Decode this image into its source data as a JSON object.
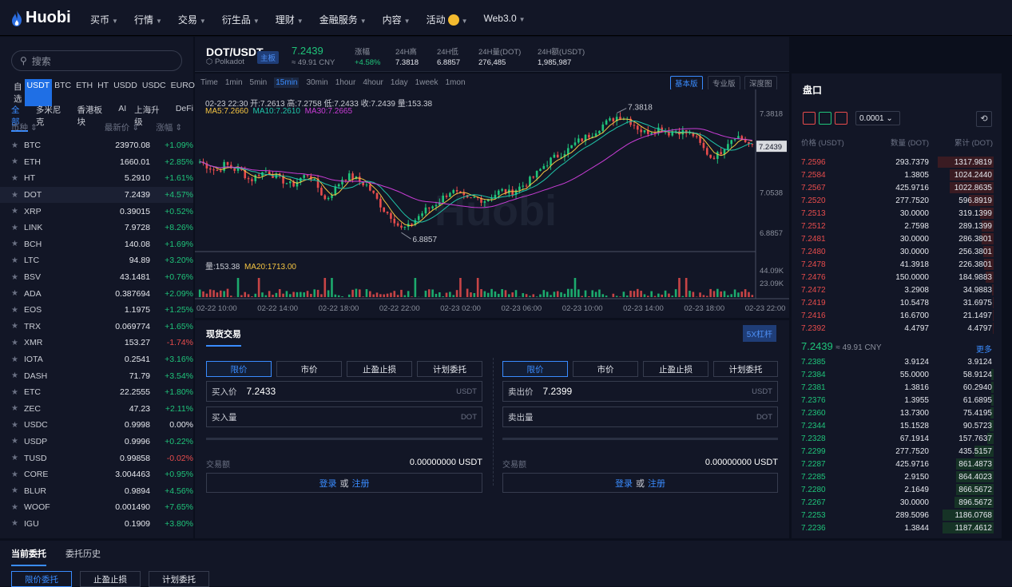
{
  "nav": {
    "logo": "Huobi",
    "items": [
      "买币",
      "行情",
      "交易",
      "衍生品",
      "理财",
      "金融服务",
      "内容",
      "活动",
      "Web3.0"
    ]
  },
  "market": {
    "search_placeholder": "搜索",
    "quote_tabs": [
      "自选",
      "USDT",
      "BTC",
      "ETH",
      "HT",
      "USDD",
      "USDC",
      "EUROC"
    ],
    "category_tabs": [
      "全部",
      "多米尼克",
      "香港板块",
      "AI",
      "上海升级",
      "DeFi"
    ],
    "headers": {
      "coin": "币种 ⇕",
      "price": "最新价 ⇕",
      "change": "涨幅 ⇕"
    },
    "rows": [
      {
        "sym": "BTC",
        "price": "23970.08",
        "change": "+1.09%",
        "dir": "up"
      },
      {
        "sym": "ETH",
        "price": "1660.01",
        "change": "+2.85%",
        "dir": "up"
      },
      {
        "sym": "HT",
        "price": "5.2910",
        "change": "+1.61%",
        "dir": "up"
      },
      {
        "sym": "DOT",
        "price": "7.2439",
        "change": "+4.57%",
        "dir": "up"
      },
      {
        "sym": "XRP",
        "price": "0.39015",
        "change": "+0.52%",
        "dir": "up"
      },
      {
        "sym": "LINK",
        "price": "7.9728",
        "change": "+8.26%",
        "dir": "up"
      },
      {
        "sym": "BCH",
        "price": "140.08",
        "change": "+1.69%",
        "dir": "up"
      },
      {
        "sym": "LTC",
        "price": "94.89",
        "change": "+3.20%",
        "dir": "up"
      },
      {
        "sym": "BSV",
        "price": "43.1481",
        "change": "+0.76%",
        "dir": "up"
      },
      {
        "sym": "ADA",
        "price": "0.387694",
        "change": "+2.09%",
        "dir": "up"
      },
      {
        "sym": "EOS",
        "price": "1.1975",
        "change": "+1.25%",
        "dir": "up"
      },
      {
        "sym": "TRX",
        "price": "0.069774",
        "change": "+1.65%",
        "dir": "up"
      },
      {
        "sym": "XMR",
        "price": "153.27",
        "change": "-1.74%",
        "dir": "dn"
      },
      {
        "sym": "IOTA",
        "price": "0.2541",
        "change": "+3.16%",
        "dir": "up"
      },
      {
        "sym": "DASH",
        "price": "71.79",
        "change": "+3.54%",
        "dir": "up"
      },
      {
        "sym": "ETC",
        "price": "22.2555",
        "change": "+1.80%",
        "dir": "up"
      },
      {
        "sym": "ZEC",
        "price": "47.23",
        "change": "+2.11%",
        "dir": "up"
      },
      {
        "sym": "USDC",
        "price": "0.9998",
        "change": "0.00%",
        "dir": "flat"
      },
      {
        "sym": "USDP",
        "price": "0.9996",
        "change": "+0.22%",
        "dir": "up"
      },
      {
        "sym": "TUSD",
        "price": "0.99858",
        "change": "-0.02%",
        "dir": "dn"
      },
      {
        "sym": "CORE",
        "price": "3.004463",
        "change": "+0.95%",
        "dir": "up"
      },
      {
        "sym": "BLUR",
        "price": "0.9894",
        "change": "+4.56%",
        "dir": "up"
      },
      {
        "sym": "WOOF",
        "price": "0.001490",
        "change": "+7.65%",
        "dir": "up"
      },
      {
        "sym": "IGU",
        "price": "0.1909",
        "change": "+3.80%",
        "dir": "up"
      }
    ]
  },
  "symbol": {
    "pair": "DOT/USDT",
    "name": "Polkadot",
    "badge": "主板",
    "price": "7.2439",
    "price_cny": "≈ 49.91 CNY",
    "stats": [
      {
        "label": "涨幅",
        "value": "+4.58%"
      },
      {
        "label": "24H高",
        "value": "7.3818"
      },
      {
        "label": "24H低",
        "value": "6.8857"
      },
      {
        "label": "24H量(DOT)",
        "value": "276,485"
      },
      {
        "label": "24H额(USDT)",
        "value": "1,985,987"
      }
    ]
  },
  "chart_toolbar": {
    "intervals": [
      "Time",
      "1min",
      "5min",
      "15min",
      "30min",
      "1hour",
      "4hour",
      "1day",
      "1week",
      "1mon"
    ],
    "active": "15min",
    "views": [
      "基本版",
      "专业版",
      "深度图"
    ]
  },
  "chart_info": {
    "ohlc": "02-23 22:30  开:7.2613  高:7.2758  低:7.2433  收:7.2439  量:153.38",
    "ma5": "MA5:7.2660",
    "ma10": "MA10:7.2610",
    "ma30": "MA30:7.2665",
    "vol": "量:153.38",
    "ma20": "MA20:1713.00",
    "high_label": "7.3818",
    "low_label": "6.8857",
    "last": "7.2439",
    "watermark": "Huobi"
  },
  "chart_data": {
    "type": "candlestick",
    "price_ticks": [
      "7.3818",
      "7.0538",
      "6.8857"
    ],
    "vol_ticks": [
      "44.09K",
      "23.09K"
    ],
    "x_ticks": [
      "02-22 10:00",
      "02-22 14:00",
      "02-22 18:00",
      "02-22 22:00",
      "02-23 02:00",
      "02-23 06:00",
      "02-23 10:00",
      "02-23 14:00",
      "02-23 18:00",
      "02-23 22:00"
    ],
    "close_path": [
      7.18,
      7.16,
      7.14,
      7.17,
      7.15,
      7.14,
      7.1,
      7.13,
      7.14,
      7.12,
      7.1,
      7.08,
      7.11,
      7.13,
      7.08,
      7.02,
      7.06,
      7.11,
      7.12,
      7.1,
      7.08,
      7.03,
      6.98,
      6.95,
      6.9,
      6.91,
      6.95,
      6.98,
      7.0,
      7.03,
      7.06,
      7.04,
      7.02,
      7.03,
      7.02,
      7.04,
      7.06,
      7.05,
      7.07,
      7.09,
      7.12,
      7.16,
      7.19,
      7.21,
      7.23,
      7.26,
      7.28,
      7.3,
      7.33,
      7.35,
      7.37,
      7.36,
      7.33,
      7.3,
      7.31,
      7.32,
      7.3,
      7.31,
      7.3,
      7.29,
      7.24,
      7.2,
      7.21,
      7.26,
      7.29,
      7.27,
      7.24
    ],
    "high": 7.3818,
    "low": 6.8857,
    "last": 7.2439
  },
  "trade": {
    "title": "现货交易",
    "leverage": "5X杠杆",
    "types": [
      "限价",
      "市价",
      "止盈止损",
      "计划委托"
    ],
    "buy": {
      "price_label": "买入价",
      "price": "7.2433",
      "qty_label": "买入量",
      "amount_label": "交易额",
      "amount": "0.00000000 USDT"
    },
    "sell": {
      "price_label": "卖出价",
      "price": "7.2399",
      "qty_label": "卖出量",
      "amount_label": "交易额",
      "amount": "0.00000000 USDT"
    },
    "unit_price": "USDT",
    "unit_qty": "DOT",
    "login": "登录",
    "or": "或",
    "register": "注册"
  },
  "book": {
    "title": "盘口",
    "precision": "0.0001 ⌄",
    "headers": [
      "价格 (USDT)",
      "数量 (DOT)",
      "累计 (DOT)"
    ],
    "asks": [
      [
        "7.2596",
        "293.7379",
        "1317.9819",
        1.0
      ],
      [
        "7.2584",
        "1.3805",
        "1024.2440",
        0.78
      ],
      [
        "7.2567",
        "425.9716",
        "1022.8635",
        0.78
      ],
      [
        "7.2520",
        "277.7520",
        "596.8919",
        0.45
      ],
      [
        "7.2513",
        "30.0000",
        "319.1399",
        0.24
      ],
      [
        "7.2512",
        "2.7598",
        "289.1399",
        0.22
      ],
      [
        "7.2481",
        "30.0000",
        "286.3801",
        0.22
      ],
      [
        "7.2480",
        "30.0000",
        "256.3801",
        0.19
      ],
      [
        "7.2478",
        "41.3918",
        "226.3801",
        0.17
      ],
      [
        "7.2476",
        "150.0000",
        "184.9883",
        0.14
      ],
      [
        "7.2472",
        "3.2908",
        "34.9883",
        0.03
      ],
      [
        "7.2419",
        "10.5478",
        "31.6975",
        0.02
      ],
      [
        "7.2416",
        "16.6700",
        "21.1497",
        0.02
      ],
      [
        "7.2392",
        "4.4797",
        "4.4797",
        0.01
      ]
    ],
    "mid": "7.2439",
    "mid_cny": "≈ 49.91 CNY",
    "more": "更多",
    "bids": [
      [
        "7.2385",
        "3.9124",
        "3.9124",
        0.0
      ],
      [
        "7.2384",
        "55.0000",
        "58.9124",
        0.05
      ],
      [
        "7.2381",
        "1.3816",
        "60.2940",
        0.05
      ],
      [
        "7.2376",
        "1.3955",
        "61.6895",
        0.05
      ],
      [
        "7.2360",
        "13.7300",
        "75.4195",
        0.06
      ],
      [
        "7.2344",
        "15.1528",
        "90.5723",
        0.07
      ],
      [
        "7.2328",
        "67.1914",
        "157.7637",
        0.12
      ],
      [
        "7.2299",
        "277.7520",
        "435.5157",
        0.34
      ],
      [
        "7.2287",
        "425.9716",
        "861.4873",
        0.67
      ],
      [
        "7.2285",
        "2.9150",
        "864.4023",
        0.67
      ],
      [
        "7.2280",
        "2.1649",
        "866.5672",
        0.67
      ],
      [
        "7.2267",
        "30.0000",
        "896.5672",
        0.7
      ],
      [
        "7.2253",
        "289.5096",
        "1186.0768",
        0.92
      ],
      [
        "7.2236",
        "1.3844",
        "1187.4612",
        0.92
      ]
    ]
  },
  "bottom": {
    "tabs": [
      "当前委托",
      "委托历史"
    ],
    "buttons": [
      "限价委托",
      "止盈止损",
      "计划委托"
    ]
  },
  "colors": {
    "up": "#1fc47a",
    "down": "#e84c4c",
    "accent": "#3a8cff",
    "ma5": "#f5c542",
    "ma10": "#1fc4a8",
    "ma30": "#c93dd6"
  }
}
